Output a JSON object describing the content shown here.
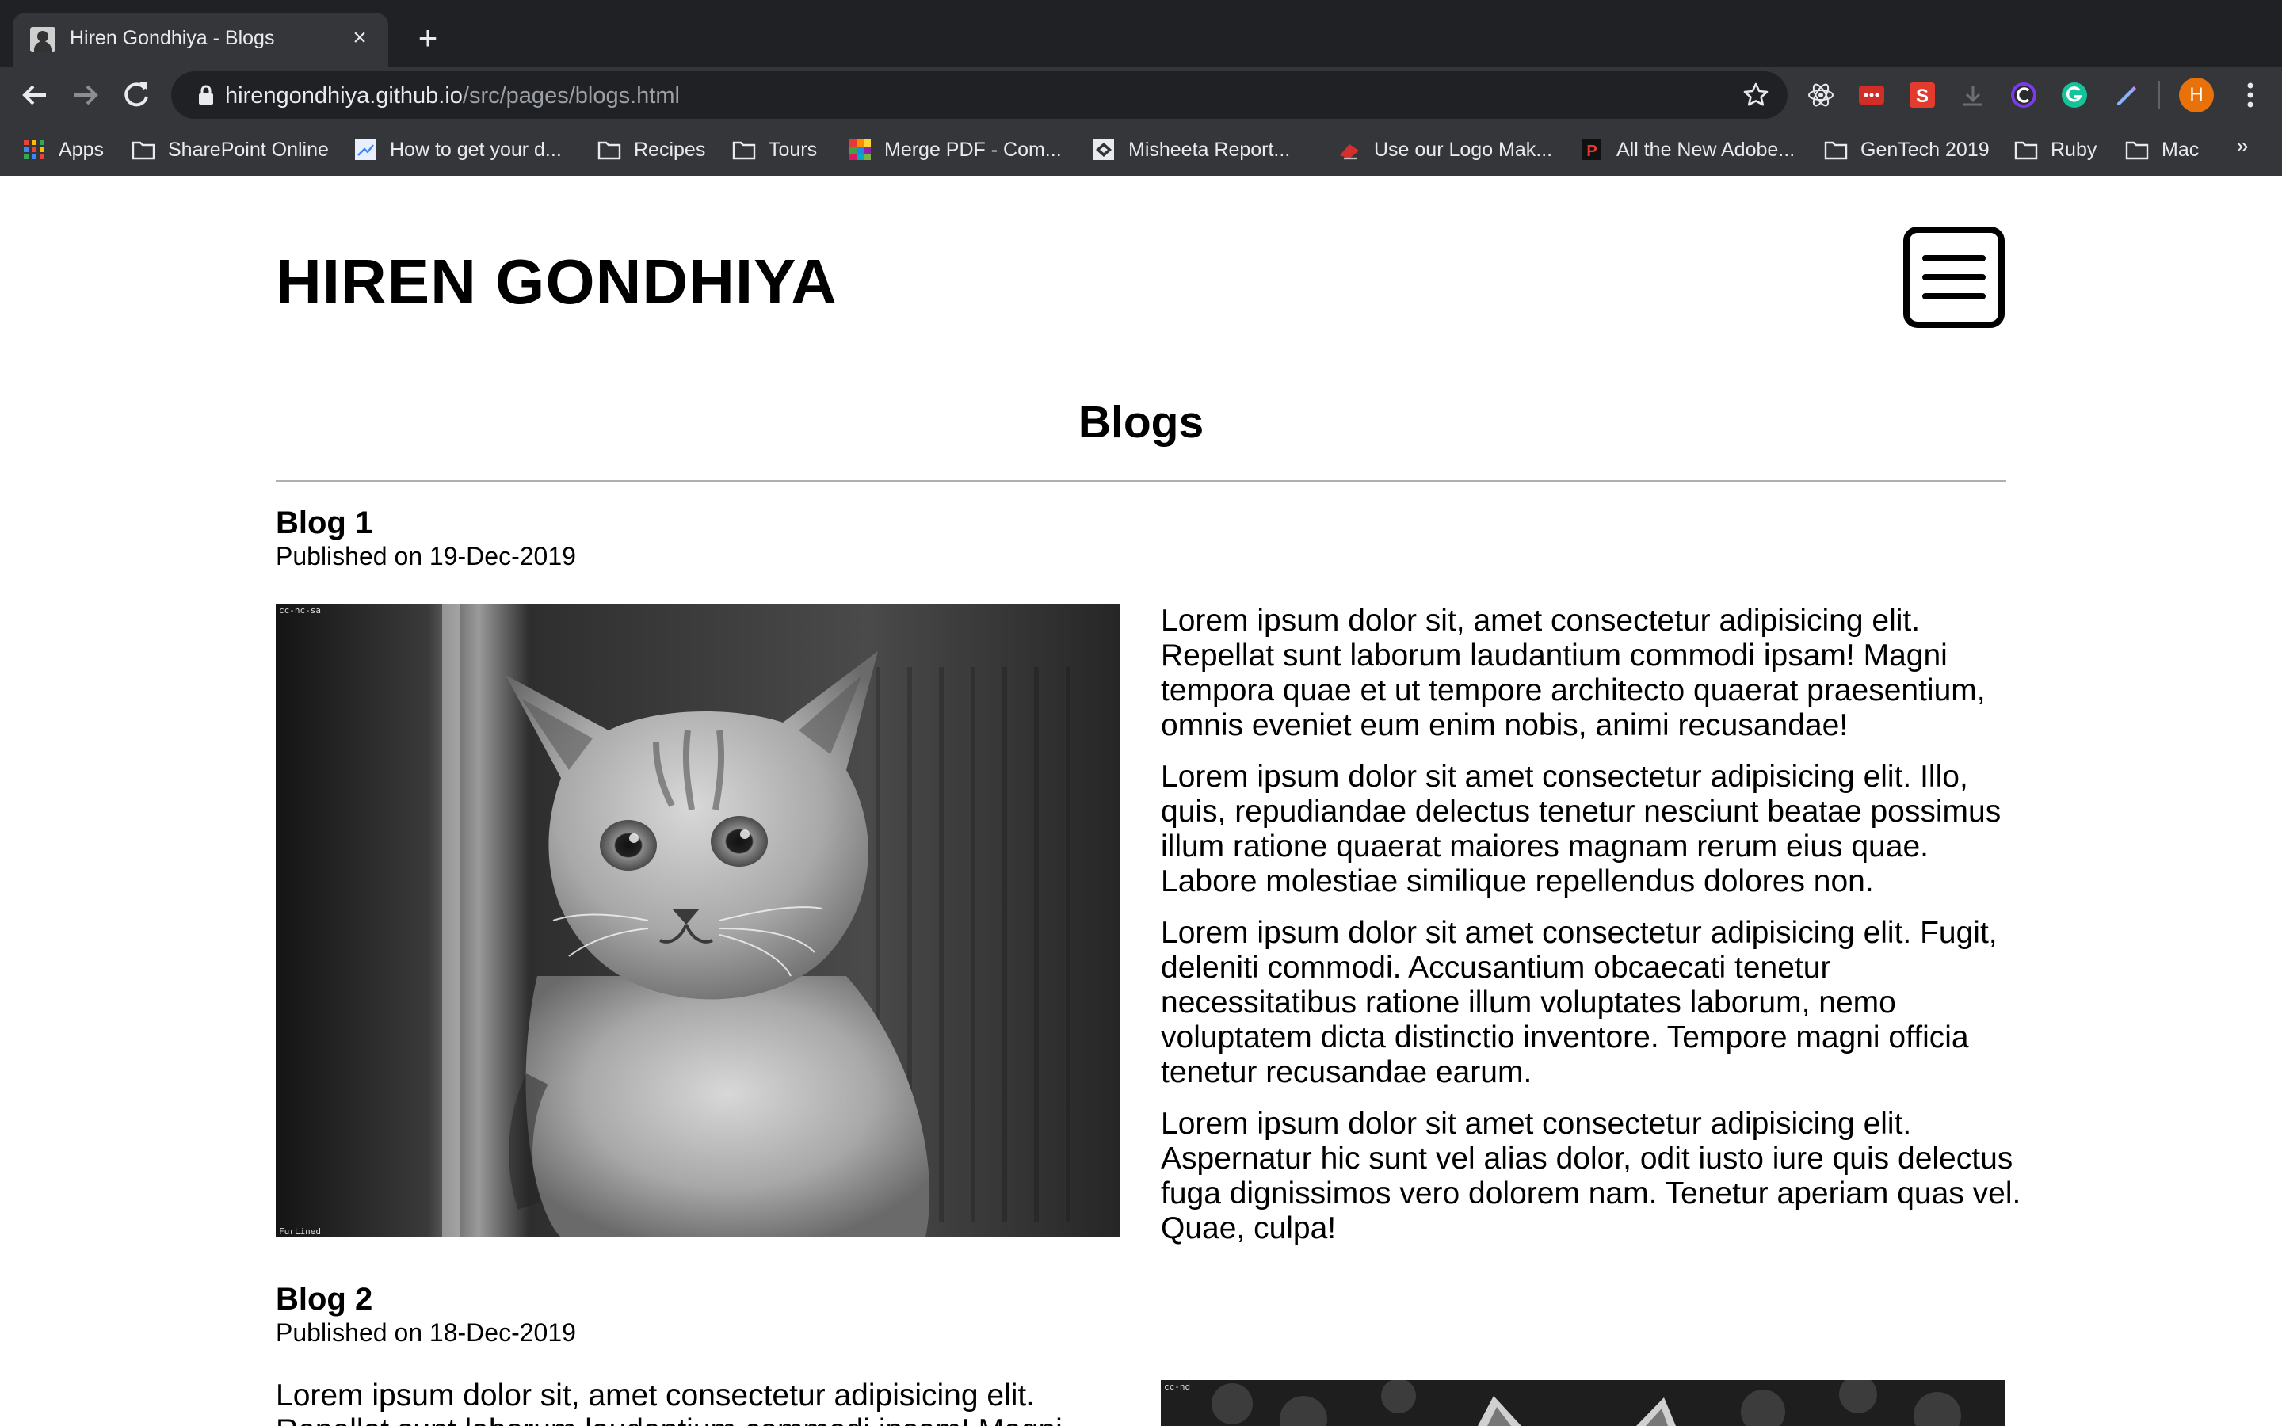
{
  "browser": {
    "tab": {
      "title": "Hiren Gondhiya - Blogs",
      "close_glyph": "×"
    },
    "new_tab_glyph": "+",
    "url": {
      "host": "hirengondhiya.github.io",
      "path": "/src/pages/blogs.html"
    },
    "profile_initial": "H",
    "bookmarks": [
      {
        "label": "Apps",
        "icon": "apps-grid-icon"
      },
      {
        "label": "SharePoint Online",
        "icon": "folder-icon"
      },
      {
        "label": "How to get your d...",
        "icon": "page-favicon-icon"
      },
      {
        "label": "Recipes",
        "icon": "folder-icon"
      },
      {
        "label": "Tours",
        "icon": "folder-icon"
      },
      {
        "label": "Merge PDF - Com...",
        "icon": "colorful-favicon-icon"
      },
      {
        "label": "Misheeta Report...",
        "icon": "misheeta-favicon-icon"
      },
      {
        "label": "Use our Logo Mak...",
        "icon": "logo-maker-favicon-icon"
      },
      {
        "label": "All the New Adobe...",
        "icon": "p-favicon-icon"
      },
      {
        "label": "GenTech 2019",
        "icon": "folder-icon"
      },
      {
        "label": "Ruby",
        "icon": "folder-icon"
      },
      {
        "label": "Mac",
        "icon": "folder-icon"
      }
    ],
    "bookmarks_overflow": "»",
    "extensions": [
      "react-devtools-icon",
      "lastpass-icon",
      "s-extension-icon",
      "download-icon",
      "c-extension-icon",
      "grammarly-icon",
      "pen-extension-icon"
    ]
  },
  "site": {
    "title": "HIREN GONDHIYA",
    "menu_icon": "hamburger-menu-icon"
  },
  "page": {
    "heading": "Blogs"
  },
  "blogs": [
    {
      "title": "Blog 1",
      "date": "Published on 19-Dec-2019",
      "image": {
        "alt": "cat-photo",
        "tag_top": "cc-nc-sa",
        "tag_bottom": "FurLined"
      },
      "paragraphs": [
        "Lorem ipsum dolor sit, amet consectetur adipisicing elit. Repellat sunt laborum laudantium commodi ipsam! Magni tempora quae et ut tempore architecto quaerat praesentium, omnis eveniet eum enim nobis, animi recusandae!",
        "Lorem ipsum dolor sit amet consectetur adipisicing elit. Illo, quis, repudiandae delectus tenetur nesciunt beatae possimus illum ratione quaerat maiores magnam rerum eius quae. Labore molestiae similique repellendus dolores non.",
        "Lorem ipsum dolor sit amet consectetur adipisicing elit. Fugit, deleniti commodi. Accusantium obcaecati tenetur necessitatibus ratione illum voluptates laborum, nemo voluptatem dicta distinctio inventore. Tempore magni officia tenetur recusandae earum.",
        "Lorem ipsum dolor sit amet consectetur adipisicing elit. Aspernatur hic sunt vel alias dolor, odit iusto iure quis delectus fuga dignissimos vero dolorem nam. Tenetur aperiam quas vel. Quae, culpa!"
      ]
    },
    {
      "title": "Blog 2",
      "date": "Published on 18-Dec-2019",
      "image": {
        "alt": "cat-photo",
        "tag_top": "cc-nd"
      },
      "paragraphs": [
        "Lorem ipsum dolor sit, amet consectetur adipisicing elit. Repellat sunt laborum laudantium commodi ipsam! Magni"
      ]
    }
  ]
}
